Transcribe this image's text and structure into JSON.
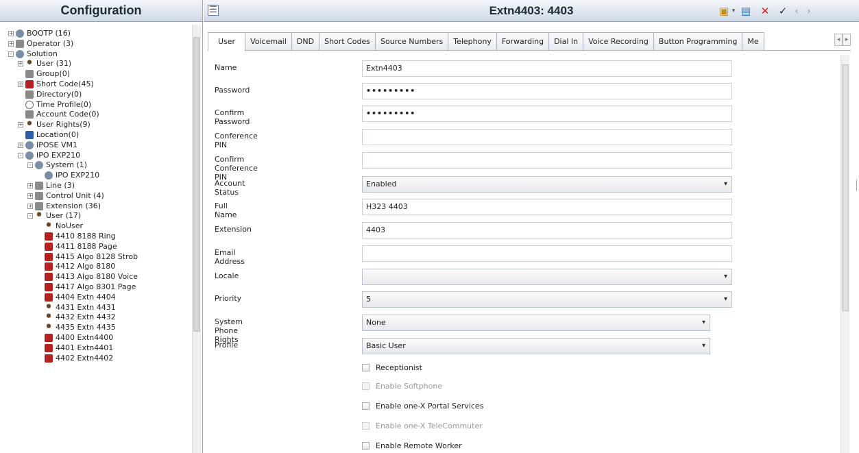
{
  "left": {
    "title": "Configuration",
    "tree": [
      {
        "label": "BOOTP (16)",
        "exp": "+",
        "icon": "gear",
        "indent": 0
      },
      {
        "label": "Operator (3)",
        "exp": "+",
        "icon": "gray",
        "indent": 0
      },
      {
        "label": "Solution",
        "exp": "-",
        "icon": "gear",
        "indent": 0
      },
      {
        "label": "User (31)",
        "exp": "+",
        "icon": "user",
        "indent": 1
      },
      {
        "label": "Group(0)",
        "exp": "",
        "icon": "gray",
        "indent": 1
      },
      {
        "label": "Short Code(45)",
        "exp": "+",
        "icon": "red",
        "indent": 1
      },
      {
        "label": "Directory(0)",
        "exp": "",
        "icon": "gray",
        "indent": 1
      },
      {
        "label": "Time Profile(0)",
        "exp": "",
        "icon": "clock",
        "indent": 1
      },
      {
        "label": "Account Code(0)",
        "exp": "",
        "icon": "gray",
        "indent": 1
      },
      {
        "label": "User Rights(9)",
        "exp": "+",
        "icon": "user",
        "indent": 1
      },
      {
        "label": "Location(0)",
        "exp": "",
        "icon": "blue",
        "indent": 1
      },
      {
        "label": "IPOSE VM1",
        "exp": "+",
        "icon": "gear",
        "indent": 1
      },
      {
        "label": "IPO EXP210",
        "exp": "-",
        "icon": "gear",
        "indent": 1
      },
      {
        "label": "System (1)",
        "exp": "-",
        "icon": "gear",
        "indent": 2
      },
      {
        "label": "IPO EXP210",
        "exp": "",
        "icon": "gear",
        "indent": 3
      },
      {
        "label": "Line (3)",
        "exp": "+",
        "icon": "gray",
        "indent": 2
      },
      {
        "label": "Control Unit (4)",
        "exp": "+",
        "icon": "gray",
        "indent": 2
      },
      {
        "label": "Extension (36)",
        "exp": "+",
        "icon": "gray",
        "indent": 2
      },
      {
        "label": "User (17)",
        "exp": "-",
        "icon": "user",
        "indent": 2
      },
      {
        "label": "NoUser",
        "exp": "",
        "icon": "user",
        "indent": 3
      },
      {
        "label": "4410 8188 Ring",
        "exp": "",
        "icon": "red",
        "indent": 3
      },
      {
        "label": "4411 8188 Page",
        "exp": "",
        "icon": "red",
        "indent": 3
      },
      {
        "label": "4415 Algo 8128 Strob",
        "exp": "",
        "icon": "red",
        "indent": 3
      },
      {
        "label": "4412 Algo 8180",
        "exp": "",
        "icon": "red",
        "indent": 3
      },
      {
        "label": "4413 Algo 8180 Voice",
        "exp": "",
        "icon": "red",
        "indent": 3
      },
      {
        "label": "4417 Algo 8301 Page",
        "exp": "",
        "icon": "red",
        "indent": 3
      },
      {
        "label": "4404 Extn 4404",
        "exp": "",
        "icon": "red",
        "indent": 3
      },
      {
        "label": "4431 Extn 4431",
        "exp": "",
        "icon": "user",
        "indent": 3
      },
      {
        "label": "4432 Extn 4432",
        "exp": "",
        "icon": "user",
        "indent": 3
      },
      {
        "label": "4435 Extn 4435",
        "exp": "",
        "icon": "user",
        "indent": 3
      },
      {
        "label": "4400 Extn4400",
        "exp": "",
        "icon": "red",
        "indent": 3
      },
      {
        "label": "4401 Extn4401",
        "exp": "",
        "icon": "red",
        "indent": 3
      },
      {
        "label": "4402 Extn4402",
        "exp": "",
        "icon": "red",
        "indent": 3
      }
    ]
  },
  "header": {
    "title": "Extn4403: 4403"
  },
  "tabs": [
    "User",
    "Voicemail",
    "DND",
    "Short Codes",
    "Source Numbers",
    "Telephony",
    "Forwarding",
    "Dial In",
    "Voice Recording",
    "Button Programming",
    "Me"
  ],
  "form": {
    "name_label": "Name",
    "name_value": "Extn4403",
    "password_label": "Password",
    "password_value": "•••••••••",
    "confirm_password_label": "Confirm Password",
    "confirm_password_value": "•••••••••",
    "conference_pin_label": "Conference PIN",
    "conference_pin_value": "",
    "confirm_conference_pin_label": "Confirm Conference PIN",
    "confirm_conference_pin_value": "",
    "account_status_label": "Account Status",
    "account_status_value": "Enabled",
    "full_name_label": "Full Name",
    "full_name_value": "H323 4403",
    "extension_label": "Extension",
    "extension_value": "4403",
    "email_label": "Email Address",
    "email_value": "",
    "locale_label": "Locale",
    "locale_value": "",
    "priority_label": "Priority",
    "priority_value": "5",
    "system_phone_rights_label": "System Phone Rights",
    "system_phone_rights_value": "None",
    "profile_label": "Profile",
    "profile_value": "Basic User",
    "receptionist": "Receptionist",
    "softphone": "Enable Softphone",
    "onex_portal": "Enable one-X Portal Services",
    "onex_telecommuter": "Enable one-X TeleCommuter",
    "remote_worker": "Enable Remote Worker"
  }
}
